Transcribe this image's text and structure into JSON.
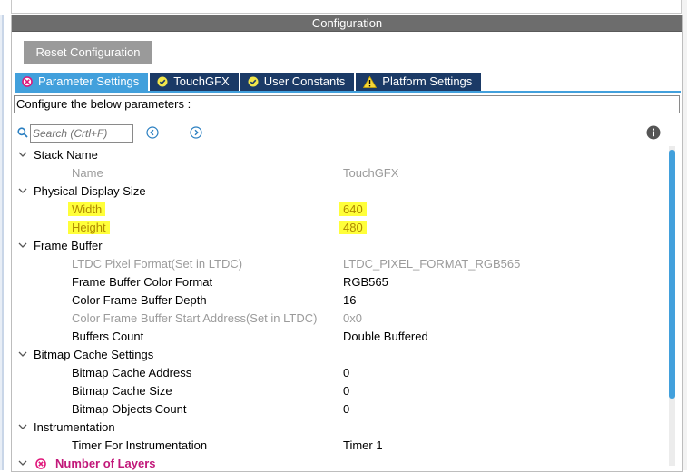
{
  "panel": {
    "title": "Configuration"
  },
  "toolbar": {
    "reset_label": "Reset Configuration"
  },
  "tabs": [
    {
      "label": "Parameter Settings",
      "icon": "error-circle-icon",
      "active": true
    },
    {
      "label": "TouchGFX",
      "icon": "check-circle-icon",
      "active": false
    },
    {
      "label": "User Constants",
      "icon": "check-circle-icon",
      "active": false
    },
    {
      "label": "Platform Settings",
      "icon": "warning-icon",
      "active": false
    }
  ],
  "description": "Configure the below parameters :",
  "search": {
    "placeholder": "Search (Crtl+F)"
  },
  "groups": [
    {
      "label": "Stack Name",
      "params": [
        {
          "label": "Name",
          "value": "TouchGFX",
          "disabled": true
        }
      ]
    },
    {
      "label": "Physical Display Size",
      "params": [
        {
          "label": "Width",
          "value": "640",
          "highlight": true
        },
        {
          "label": "Height",
          "value": "480",
          "highlight": true
        }
      ]
    },
    {
      "label": "Frame Buffer",
      "params": [
        {
          "label": "LTDC Pixel Format(Set in LTDC)",
          "value": "LTDC_PIXEL_FORMAT_RGB565",
          "disabled": true
        },
        {
          "label": "Frame Buffer Color Format",
          "value": "RGB565"
        },
        {
          "label": "Color Frame Buffer Depth",
          "value": "16"
        },
        {
          "label": "Color Frame Buffer Start Address(Set in LTDC)",
          "value": "0x0",
          "disabled": true
        },
        {
          "label": "Buffers Count",
          "value": "Double Buffered"
        }
      ]
    },
    {
      "label": "Bitmap Cache Settings",
      "params": [
        {
          "label": "Bitmap Cache Address",
          "value": "0"
        },
        {
          "label": "Bitmap Cache Size",
          "value": "0"
        },
        {
          "label": "Bitmap Objects Count",
          "value": "0"
        }
      ]
    },
    {
      "label": "Instrumentation",
      "params": [
        {
          "label": "Timer For Instrumentation",
          "value": "Timer 1"
        }
      ]
    },
    {
      "label": "Number of Layers",
      "params": [],
      "error": true
    }
  ],
  "colors": {
    "accent": "#42a0dc",
    "tab_bg": "#1b3a66",
    "header_bg": "#6d6d6d",
    "highlight": "#ffff3a",
    "error": "#c2187a"
  }
}
